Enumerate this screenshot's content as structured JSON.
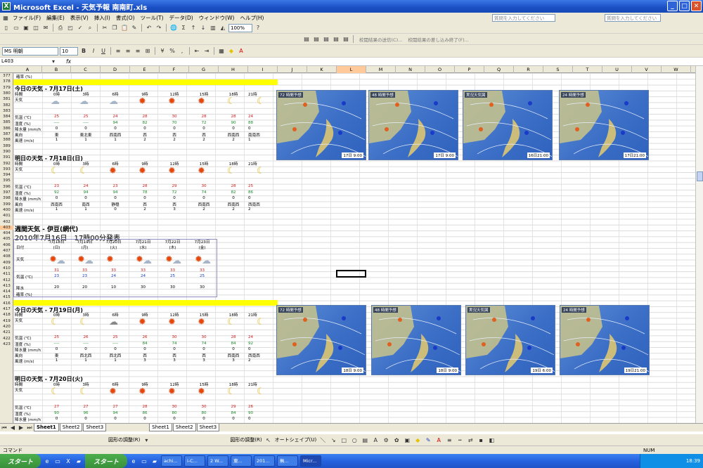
{
  "window": {
    "title": "Microsoft Excel - 天気予報 南南町.xls",
    "help_placeholder": "質問を入力してください"
  },
  "menu": [
    "ファイル(F)",
    "編集(E)",
    "表示(V)",
    "挿入(I)",
    "書式(O)",
    "ツール(T)",
    "データ(D)",
    "ウィンドウ(W)",
    "ヘルプ(H)"
  ],
  "toolbar": {
    "zoom": "100%",
    "font": "MS 明朝",
    "size": "10",
    "review_a": "校閲結果の送信(C)...",
    "review_b": "校閲結果の差し込み終了(F)..."
  },
  "formula": {
    "cell": "L403"
  },
  "columns": [
    "A",
    "B",
    "C",
    "D",
    "E",
    "F",
    "G",
    "H",
    "I",
    "J",
    "K",
    "L",
    "M",
    "N",
    "O",
    "P",
    "Q",
    "R",
    "S",
    "T",
    "U",
    "V",
    "W"
  ],
  "rows": [
    "377",
    "378",
    "379",
    "380",
    "381",
    "382",
    "383",
    "384",
    "385",
    "386",
    "387",
    "388",
    "389",
    "390",
    "391",
    "392",
    "393",
    "394",
    "395",
    "396",
    "397",
    "398",
    "399",
    "400",
    "401",
    "402",
    "403",
    "404",
    "405",
    "406",
    "407",
    "408",
    "409",
    "410",
    "411",
    "412",
    "413",
    "414",
    "415",
    "416",
    "417",
    "418",
    "419",
    "420",
    "421",
    "422",
    "423"
  ],
  "row377_label": "確率 (%)",
  "today": {
    "title": "今日の天気 - 7月17日(土)",
    "times": [
      "0時",
      "3時",
      "6時",
      "9時",
      "12時",
      "15時",
      "18時",
      "21時"
    ],
    "labels": [
      "時間",
      "天気",
      "気温 (℃)",
      "湿度 (%)",
      "降水量 (mm/h)",
      "風向",
      "風速 (m/s)"
    ],
    "temp": [
      "25",
      "25",
      "24",
      "28",
      "30",
      "28",
      "28",
      "24"
    ],
    "hum": [
      "----",
      "----",
      "94",
      "82",
      "70",
      "72",
      "90",
      "88"
    ],
    "rain": [
      "0",
      "0",
      "0",
      "0",
      "0",
      "0",
      "0",
      "0"
    ],
    "wind_dir": [
      "東",
      "東北東",
      "西南西",
      "西",
      "西",
      "西",
      "西南西",
      "南南西"
    ],
    "wind_spd": [
      "1",
      "1",
      "1",
      "2",
      "2",
      "2",
      "2",
      "1"
    ]
  },
  "tomorrow": {
    "title": "明日の天気 - 7月18日(日)",
    "times": [
      "0時",
      "3時",
      "6時",
      "9時",
      "12時",
      "15時",
      "18時",
      "21時"
    ],
    "temp": [
      "23",
      "24",
      "23",
      "28",
      "29",
      "30",
      "28",
      "25"
    ],
    "hum": [
      "92",
      "94",
      "94",
      "78",
      "72",
      "74",
      "82",
      "86"
    ],
    "rain": [
      "0",
      "0",
      "0",
      "0",
      "0",
      "0",
      "0",
      "0"
    ],
    "wind_dir": [
      "西南西",
      "南西",
      "静穏",
      "西",
      "西",
      "西南西",
      "西南西",
      "西南西"
    ],
    "wind_spd": [
      "1",
      "1",
      "0",
      "2",
      "3",
      "2",
      "2",
      "2"
    ]
  },
  "weekly": {
    "title": "週間天気 - 伊豆(網代)",
    "date": "2010年7月16日　17時00分発表",
    "days": [
      "7月18日",
      "7月19日",
      "7月20日",
      "7月21日",
      "7月22日",
      "7月23日"
    ],
    "weekdays": [
      "(日)",
      "(月)",
      "(火)",
      "(水)",
      "(木)",
      "(金)"
    ],
    "labels": [
      "日付",
      "天気",
      "気温 (℃)",
      "降水",
      "確率 (%)"
    ],
    "hi": [
      "31",
      "33",
      "33",
      "33",
      "33",
      "33"
    ],
    "lo": [
      "23",
      "23",
      "24",
      "24",
      "25",
      "25"
    ],
    "pop": [
      "20",
      "20",
      "10",
      "30",
      "30",
      "30"
    ]
  },
  "today2": {
    "title": "今日の天気 - 7月19日(月)",
    "times": [
      "0時",
      "3時",
      "6時",
      "9時",
      "12時",
      "15時",
      "18時",
      "21時"
    ],
    "temp": [
      "25",
      "26",
      "25",
      "26",
      "30",
      "30",
      "28",
      "24"
    ],
    "hum": [
      "----",
      "----",
      "----",
      "84",
      "74",
      "74",
      "84",
      "92"
    ],
    "rain": [
      "0",
      "0",
      "0",
      "0",
      "0",
      "0",
      "0",
      "0"
    ],
    "wind_dir": [
      "東",
      "西北西",
      "西北西",
      "西",
      "西",
      "西",
      "西南西",
      "西南西"
    ],
    "wind_spd": [
      "1",
      "1",
      "1",
      "3",
      "3",
      "3",
      "3",
      "2"
    ]
  },
  "tomorrow2": {
    "title": "明日の天気 - 7月20日(火)",
    "times": [
      "0時",
      "3時",
      "6時",
      "9時",
      "12時",
      "15時",
      "18時",
      "21時"
    ],
    "temp": [
      "27",
      "27",
      "27",
      "28",
      "30",
      "30",
      "29",
      "26"
    ],
    "hum": [
      "90",
      "96",
      "94",
      "86",
      "80",
      "80",
      "84",
      "90"
    ],
    "rain": [
      "0",
      "0",
      "0",
      "0",
      "0",
      "0",
      "0",
      "0"
    ]
  },
  "maps": [
    {
      "label": "72 時間予想",
      "time": "17日 9:00"
    },
    {
      "label": "48 時間予想",
      "time": "17日 9:00"
    },
    {
      "label": "実況天気図",
      "time": "16日21:00"
    },
    {
      "label": "24 時間予想",
      "time": "17日21:00"
    },
    {
      "label": "72 時間予想",
      "time": "18日 9:00"
    },
    {
      "label": "48 時間予想",
      "time": "18日 9:00"
    },
    {
      "label": "実況天気図",
      "time": "19日 6:00"
    },
    {
      "label": "24 時間予想",
      "time": "19日21:00"
    }
  ],
  "sheets": [
    "Sheet1",
    "Sheet2",
    "Sheet3"
  ],
  "draw": {
    "adjust": "図形の調整(R)",
    "autoshape": "オートシェイプ(U)"
  },
  "status": {
    "left": "コマンド",
    "num": "NUM"
  },
  "taskbar": {
    "start": "スタート",
    "clock": "18:39",
    "tasks": [
      "achi...",
      "i-C...",
      "2 W...",
      "東...",
      "201...",
      "無...",
      "Micr..."
    ]
  }
}
